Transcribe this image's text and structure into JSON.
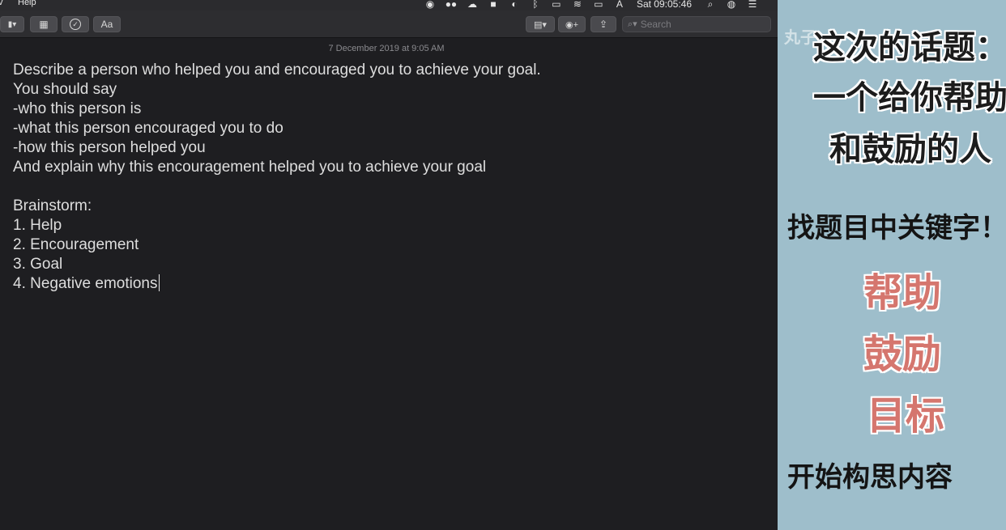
{
  "menubar": {
    "menu_partial": "v",
    "help": "Help",
    "clock": "Sat 09:05:46",
    "icons": [
      "record-icon",
      "wechat-icon",
      "creative-cloud-icon",
      "app-icon",
      "vpn-icon",
      "bluetooth-icon",
      "airplay-icon",
      "wifi-icon",
      "battery-icon",
      "input-source-icon",
      "spotlight-icon",
      "siri-icon",
      "notification-center-icon"
    ],
    "input_source_glyph": "A"
  },
  "toolbar": {
    "lock_glyph": "🔒",
    "table_glyph": "▦",
    "checklist_glyph": "✓",
    "format_label": "Aa",
    "attachments_glyph": "▤",
    "collaborate_glyph": "⊕",
    "share_glyph": "⇪",
    "search_placeholder": "Search"
  },
  "note": {
    "date": "7 December 2019 at 9:05 AM",
    "lines": [
      "Describe a person who helped you and encouraged you to achieve your goal.",
      "You should say",
      "-who this person is",
      "-what this person encouraged you to do",
      "-how this person helped you",
      "And explain why this encouragement helped you to achieve your goal",
      "",
      "Brainstorm:",
      "1. Help",
      "2. Encouragement",
      "3. Goal",
      "4. Negative emotions"
    ]
  },
  "panel": {
    "watermark": "丸子",
    "title_line1": "这次的话题：",
    "title_line2": "一个给你帮助",
    "title_line3": "和鼓励的人",
    "keywords_heading": "找题目中关键字！",
    "keywords": [
      "帮助",
      "鼓励",
      "目标"
    ],
    "next_step": "开始构思内容"
  },
  "colors": {
    "panel_bg": "#9ebecb",
    "keyword_pink": "#d5766e",
    "notes_bg": "#1e1e21"
  }
}
